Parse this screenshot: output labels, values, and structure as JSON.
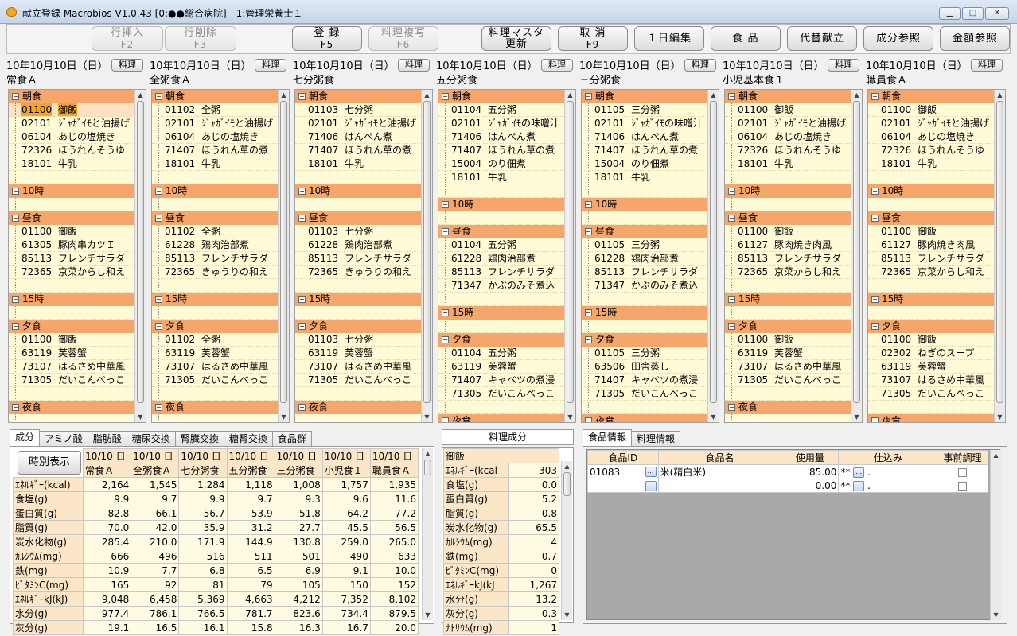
{
  "window": {
    "title": "献立登録 Macrobios V1.0.43 [0:●●総合病院]  - 1:管理栄養士１ -",
    "min": "▁",
    "max": "□",
    "close": "✕"
  },
  "toolbar": {
    "insert_row": "行挿入",
    "insert_row_key": "F2",
    "delete_row": "行削除",
    "delete_row_key": "F3",
    "register": "登 録",
    "register_key": "F5",
    "copy_dish": "料理複写",
    "copy_dish_key": "F6",
    "update_master": "料理マスタ",
    "update_master_2": "更新",
    "cancel": "取 消",
    "cancel_key": "F9",
    "edit_day": "１日編集",
    "food": "食 品",
    "alt_menu": "代替献立",
    "ref_ingredients": "成分参照",
    "ref_price": "金額参照"
  },
  "ryori_label": "料理",
  "columns": [
    {
      "date": "10年10月10日（日）",
      "name": "常食Ａ",
      "meals": [
        {
          "label": "朝食",
          "dishes": [
            [
              "01100",
              "御飯"
            ],
            [
              "02101",
              "ｼﾞｬｶﾞｲﾓと油揚げ"
            ],
            [
              "06104",
              "あじの塩焼き"
            ],
            [
              "72326",
              "ほうれんそうゆ"
            ],
            [
              "18101",
              "牛乳"
            ]
          ]
        },
        {
          "label": "10時",
          "dishes": []
        },
        {
          "label": "昼食",
          "dishes": [
            [
              "01100",
              "御飯"
            ],
            [
              "61305",
              "豚肉串カツＩ"
            ],
            [
              "85113",
              "フレンチサラダ"
            ],
            [
              "72365",
              "京菜からし和え"
            ]
          ]
        },
        {
          "label": "15時",
          "dishes": []
        },
        {
          "label": "夕食",
          "dishes": [
            [
              "01100",
              "御飯"
            ],
            [
              "63119",
              "芙蓉蟹"
            ],
            [
              "73107",
              "はるさめ中華風"
            ],
            [
              "71305",
              "だいこんべっこ"
            ]
          ]
        },
        {
          "label": "夜食",
          "dishes": []
        }
      ]
    },
    {
      "date": "10年10月10日（日）",
      "name": "全粥食Ａ",
      "meals": [
        {
          "label": "朝食",
          "dishes": [
            [
              "01102",
              "全粥"
            ],
            [
              "02101",
              "ｼﾞｬｶﾞｲﾓと油揚げ"
            ],
            [
              "06104",
              "あじの塩焼き"
            ],
            [
              "71407",
              "ほうれん草の煮"
            ],
            [
              "18101",
              "牛乳"
            ]
          ]
        },
        {
          "label": "10時",
          "dishes": []
        },
        {
          "label": "昼食",
          "dishes": [
            [
              "01102",
              "全粥"
            ],
            [
              "61228",
              "鶏肉治部煮"
            ],
            [
              "85113",
              "フレンチサラダ"
            ],
            [
              "72365",
              "きゅうりの和え"
            ]
          ]
        },
        {
          "label": "15時",
          "dishes": []
        },
        {
          "label": "夕食",
          "dishes": [
            [
              "01102",
              "全粥"
            ],
            [
              "63119",
              "芙蓉蟹"
            ],
            [
              "73107",
              "はるさめ中華風"
            ],
            [
              "71305",
              "だいこんべっこ"
            ]
          ]
        },
        {
          "label": "夜食",
          "dishes": []
        }
      ]
    },
    {
      "date": "10年10月10日（日）",
      "name": "七分粥食",
      "meals": [
        {
          "label": "朝食",
          "dishes": [
            [
              "01103",
              "七分粥"
            ],
            [
              "02101",
              "ｼﾞｬｶﾞｲﾓと油揚げ"
            ],
            [
              "71406",
              "はんぺん煮"
            ],
            [
              "71407",
              "ほうれん草の煮"
            ],
            [
              "18101",
              "牛乳"
            ]
          ]
        },
        {
          "label": "10時",
          "dishes": []
        },
        {
          "label": "昼食",
          "dishes": [
            [
              "01103",
              "七分粥"
            ],
            [
              "61228",
              "鶏肉治部煮"
            ],
            [
              "85113",
              "フレンチサラダ"
            ],
            [
              "72365",
              "きゅうりの和え"
            ]
          ]
        },
        {
          "label": "15時",
          "dishes": []
        },
        {
          "label": "夕食",
          "dishes": [
            [
              "01103",
              "七分粥"
            ],
            [
              "63119",
              "芙蓉蟹"
            ],
            [
              "73107",
              "はるさめ中華風"
            ],
            [
              "71305",
              "だいこんべっこ"
            ]
          ]
        },
        {
          "label": "夜食",
          "dishes": []
        }
      ]
    },
    {
      "date": "10年10月10日（日）",
      "name": "五分粥食",
      "meals": [
        {
          "label": "朝食",
          "dishes": [
            [
              "01104",
              "五分粥"
            ],
            [
              "02101",
              "ｼﾞｬｶﾞｲﾓの味噌汁"
            ],
            [
              "71406",
              "はんぺん煮"
            ],
            [
              "71407",
              "ほうれん草の煮"
            ],
            [
              "15004",
              "のり佃煮"
            ],
            [
              "18101",
              "牛乳"
            ]
          ]
        },
        {
          "label": "10時",
          "dishes": []
        },
        {
          "label": "昼食",
          "dishes": [
            [
              "01104",
              "五分粥"
            ],
            [
              "61228",
              "鶏肉治部煮"
            ],
            [
              "85113",
              "フレンチサラダ"
            ],
            [
              "71347",
              "かぶのみそ煮込"
            ]
          ]
        },
        {
          "label": "15時",
          "dishes": []
        },
        {
          "label": "夕食",
          "dishes": [
            [
              "01104",
              "五分粥"
            ],
            [
              "63119",
              "芙蓉蟹"
            ],
            [
              "71407",
              "キャベツの煮浸"
            ],
            [
              "71305",
              "だいこんべっこ"
            ]
          ]
        },
        {
          "label": "夜食",
          "dishes": []
        }
      ]
    },
    {
      "date": "10年10月10日（日）",
      "name": "三分粥食",
      "meals": [
        {
          "label": "朝食",
          "dishes": [
            [
              "01105",
              "三分粥"
            ],
            [
              "02101",
              "ｼﾞｬｶﾞｲﾓの味噌汁"
            ],
            [
              "71406",
              "はんぺん煮"
            ],
            [
              "71407",
              "ほうれん草の煮"
            ],
            [
              "15004",
              "のり佃煮"
            ],
            [
              "18101",
              "牛乳"
            ]
          ]
        },
        {
          "label": "10時",
          "dishes": []
        },
        {
          "label": "昼食",
          "dishes": [
            [
              "01105",
              "三分粥"
            ],
            [
              "61228",
              "鶏肉治部煮"
            ],
            [
              "85113",
              "フレンチサラダ"
            ],
            [
              "71347",
              "かぶのみそ煮込"
            ]
          ]
        },
        {
          "label": "15時",
          "dishes": []
        },
        {
          "label": "夕食",
          "dishes": [
            [
              "01105",
              "三分粥"
            ],
            [
              "63506",
              "田舎蒸し"
            ],
            [
              "71407",
              "キャベツの煮浸"
            ],
            [
              "71305",
              "だいこんべっこ"
            ]
          ]
        },
        {
          "label": "夜食",
          "dishes": []
        }
      ]
    },
    {
      "date": "10年10月10日（日）",
      "name": "小児基本食１",
      "meals": [
        {
          "label": "朝食",
          "dishes": [
            [
              "01100",
              "御飯"
            ],
            [
              "02101",
              "ｼﾞｬｶﾞｲﾓと油揚げ"
            ],
            [
              "06104",
              "あじの塩焼き"
            ],
            [
              "72326",
              "ほうれんそうゆ"
            ],
            [
              "18101",
              "牛乳"
            ]
          ]
        },
        {
          "label": "10時",
          "dishes": []
        },
        {
          "label": "昼食",
          "dishes": [
            [
              "01100",
              "御飯"
            ],
            [
              "61127",
              "豚肉焼き肉風"
            ],
            [
              "85113",
              "フレンチサラダ"
            ],
            [
              "72365",
              "京菜からし和え"
            ]
          ]
        },
        {
          "label": "15時",
          "dishes": []
        },
        {
          "label": "夕食",
          "dishes": [
            [
              "01100",
              "御飯"
            ],
            [
              "63119",
              "芙蓉蟹"
            ],
            [
              "73107",
              "はるさめ中華風"
            ],
            [
              "71305",
              "だいこんべっこ"
            ]
          ]
        },
        {
          "label": "夜食",
          "dishes": []
        }
      ]
    },
    {
      "date": "10年10月10日（日）",
      "name": "職員食Ａ",
      "meals": [
        {
          "label": "朝食",
          "dishes": [
            [
              "01100",
              "御飯"
            ],
            [
              "02101",
              "ｼﾞｬｶﾞｲﾓと油揚げ"
            ],
            [
              "06104",
              "あじの塩焼き"
            ],
            [
              "72326",
              "ほうれんそうゆ"
            ],
            [
              "18101",
              "牛乳"
            ]
          ]
        },
        {
          "label": "10時",
          "dishes": []
        },
        {
          "label": "昼食",
          "dishes": [
            [
              "01100",
              "御飯"
            ],
            [
              "61127",
              "豚肉焼き肉風"
            ],
            [
              "85113",
              "フレンチサラダ"
            ],
            [
              "72365",
              "京菜からし和え"
            ]
          ]
        },
        {
          "label": "15時",
          "dishes": []
        },
        {
          "label": "夕食",
          "dishes": [
            [
              "01100",
              "御飯"
            ],
            [
              "02302",
              "ねぎのスープ"
            ],
            [
              "63119",
              "芙蓉蟹"
            ],
            [
              "73107",
              "はるさめ中華風"
            ],
            [
              "71305",
              "だいこんべっこ"
            ]
          ]
        },
        {
          "label": "夜食",
          "dishes": []
        }
      ]
    }
  ],
  "nutrition_tabs": [
    "成分",
    "アミノ酸",
    "脂肪酸",
    "糖尿交換",
    "腎臓交換",
    "糖腎交換",
    "食品群"
  ],
  "nutrition": {
    "time_button": "時別表示",
    "dates": [
      "10/10 日",
      "10/10 日",
      "10/10 日",
      "10/10 日",
      "10/10 日",
      "10/10 日",
      "10/10 日"
    ],
    "menus": [
      "常食Ａ",
      "全粥食Ａ",
      "七分粥食",
      "五分粥食",
      "三分粥食",
      "小児食１",
      "職員食Ａ"
    ],
    "rows": [
      {
        "label": "ｴﾈﾙｷﾞｰ(kcal)",
        "values": [
          "2,164",
          "1,545",
          "1,284",
          "1,118",
          "1,008",
          "1,757",
          "1,935"
        ]
      },
      {
        "label": "食塩(g)",
        "values": [
          "9.9",
          "9.7",
          "9.9",
          "9.7",
          "9.3",
          "9.6",
          "11.6"
        ]
      },
      {
        "label": "蛋白質(g)",
        "values": [
          "82.8",
          "66.1",
          "56.7",
          "53.9",
          "51.8",
          "64.2",
          "77.2"
        ]
      },
      {
        "label": "脂質(g)",
        "values": [
          "70.0",
          "42.0",
          "35.9",
          "31.2",
          "27.7",
          "45.5",
          "56.5"
        ]
      },
      {
        "label": "炭水化物(g)",
        "values": [
          "285.4",
          "210.0",
          "171.9",
          "144.9",
          "130.8",
          "259.0",
          "265.0"
        ]
      },
      {
        "label": "ｶﾙｼｳﾑ(mg)",
        "values": [
          "666",
          "496",
          "516",
          "511",
          "501",
          "490",
          "633"
        ]
      },
      {
        "label": "鉄(mg)",
        "values": [
          "10.9",
          "7.7",
          "6.8",
          "6.5",
          "6.9",
          "9.1",
          "10.0"
        ]
      },
      {
        "label": "ﾋﾞﾀﾐﾝC(mg)",
        "values": [
          "165",
          "92",
          "81",
          "79",
          "105",
          "150",
          "152"
        ]
      },
      {
        "label": "ｴﾈﾙｷﾞｰkJ(kJ)",
        "values": [
          "9,048",
          "6,458",
          "5,369",
          "4,663",
          "4,212",
          "7,352",
          "8,102"
        ]
      },
      {
        "label": "水分(g)",
        "values": [
          "977.4",
          "786.1",
          "766.5",
          "781.7",
          "823.6",
          "734.4",
          "879.5"
        ]
      },
      {
        "label": "灰分(g)",
        "values": [
          "19.1",
          "16.5",
          "16.1",
          "15.8",
          "16.3",
          "16.7",
          "20.0"
        ]
      }
    ]
  },
  "dish_nutrition": {
    "title": "料理成分",
    "dish": "御飯",
    "rows": [
      {
        "label": "ｴﾈﾙｷﾞｰ(kcal",
        "value": "303"
      },
      {
        "label": "食塩(g)",
        "value": "0.0"
      },
      {
        "label": "蛋白質(g)",
        "value": "5.2"
      },
      {
        "label": "脂質(g)",
        "value": "0.8"
      },
      {
        "label": "炭水化物(g)",
        "value": "65.5"
      },
      {
        "label": "ｶﾙｼｳﾑ(mg)",
        "value": "4"
      },
      {
        "label": "鉄(mg)",
        "value": "0.7"
      },
      {
        "label": "ﾋﾞﾀﾐﾝC(mg)",
        "value": "0"
      },
      {
        "label": "ｴﾈﾙｷﾞｰkJ(kJ",
        "value": "1,267"
      },
      {
        "label": "水分(g)",
        "value": "13.2"
      },
      {
        "label": "灰分(g)",
        "value": "0.3"
      },
      {
        "label": "ﾅﾄﾘｳﾑ(mg)",
        "value": "1"
      }
    ]
  },
  "food_tabs": [
    "食品情報",
    "料理情報"
  ],
  "food_table": {
    "headers": [
      "食品ID",
      "食品名",
      "使用量",
      "仕込み",
      "事前調理"
    ],
    "rows": [
      {
        "id": "01083",
        "name": "米(精白米)",
        "amount": "85.00",
        "unit": "**",
        "prep": "."
      },
      {
        "id": "",
        "name": "",
        "amount": "0.00",
        "unit": "**",
        "prep": "."
      }
    ],
    "btn": "…"
  }
}
